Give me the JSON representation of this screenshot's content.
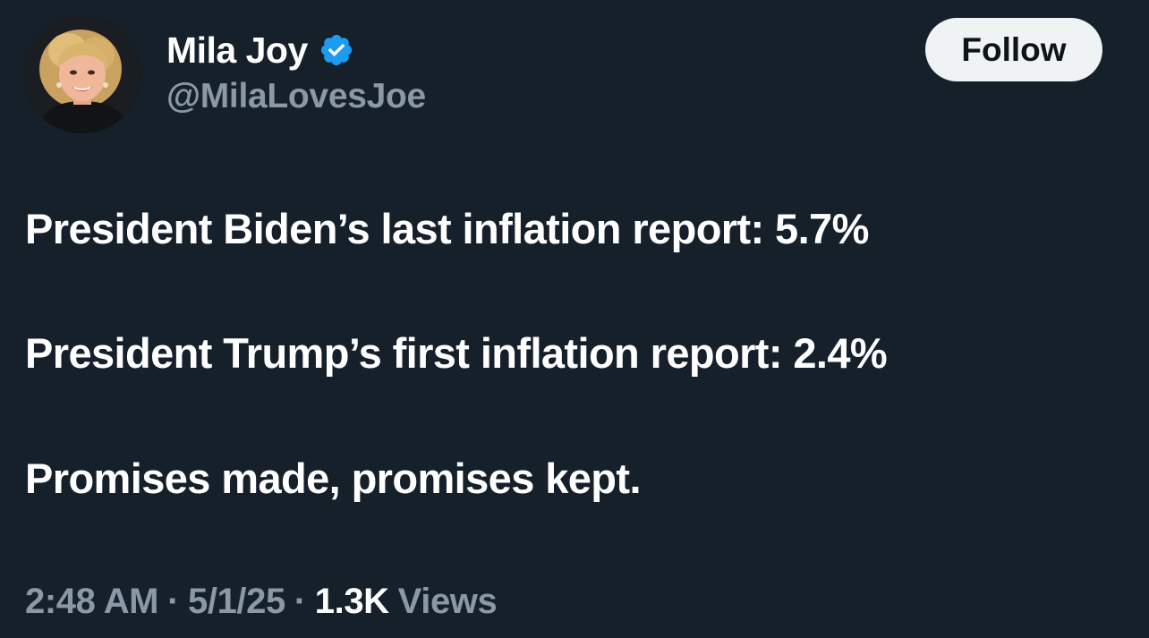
{
  "user": {
    "display_name": "Mila Joy",
    "handle": "@MilaLovesJoe",
    "verified": true,
    "verified_icon": "verified-badge-icon",
    "verified_color": "#1d9bf0"
  },
  "follow_button": {
    "label": "Follow"
  },
  "tweet": {
    "lines": [
      "President Biden’s last inflation report: 5.7%",
      "President Trump’s first inflation report: 2.4%",
      "Promises made, promises kept."
    ]
  },
  "meta": {
    "time": "2:48 AM",
    "separator": "·",
    "date": "5/1/25",
    "views_count": "1.3K",
    "views_label": "Views"
  },
  "colors": {
    "background": "#15202b",
    "text_primary": "#ffffff",
    "text_secondary": "#8b98a5",
    "button_bg": "#eff3f4",
    "button_text": "#0f1419"
  }
}
